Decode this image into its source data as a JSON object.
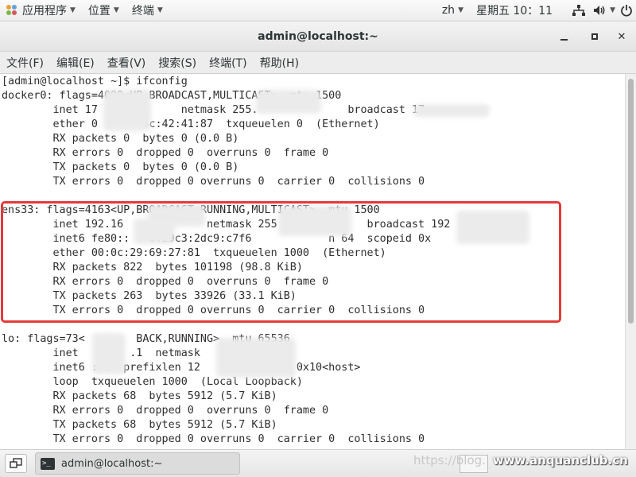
{
  "top_panel": {
    "applications": "应用程序",
    "places": "位置",
    "terminal": "终端",
    "input_method": "zh",
    "clock": "星期五 10：11",
    "icons": [
      "network-icon",
      "volume-icon",
      "power-icon"
    ]
  },
  "window": {
    "title": "admin@localhost:~",
    "controls": [
      "minimize-icon",
      "maximize-icon",
      "close-icon"
    ]
  },
  "menubar": {
    "items": [
      "文件(F)",
      "编辑(E)",
      "查看(V)",
      "搜索(S)",
      "终端(T)",
      "帮助(H)"
    ]
  },
  "terminal": {
    "lines": [
      "[admin@localhost ~]$ ifconfig",
      "docker0: flags=4099<UP,BROADCAST,MULTICAST>  mtu 1500",
      "        inet 17             netmask 255.              broadcast 17",
      "        ether 0       4c:42:41:87  txqueuelen 0  (Ethernet)",
      "        RX packets 0  bytes 0 (0.0 B)",
      "        RX errors 0  dropped 0  overruns 0  frame 0",
      "        TX packets 0  bytes 0 (0.0 B)",
      "        TX errors 0  dropped 0 overruns 0  carrier 0  collisions 0",
      "",
      "ens33: flags=4163<UP,BROADCAST,RUNNING,MULTICAST>  mtu 1500",
      "        inet 192.16             netmask 255              broadcast 192",
      "        inet6 fe80::   0:29c3:2dc9:c7f6            n 64  scopeid 0x",
      "        ether 00:0c:29:69:27:81  txqueuelen 1000  (Ethernet)",
      "        RX packets 822  bytes 101198 (98.8 KiB)",
      "        RX errors 0  dropped 0  overruns 0  frame 0",
      "        TX packets 263  bytes 33926 (33.1 KiB)",
      "        TX errors 0  dropped 0 overruns 0  carrier 0  collisions 0",
      "",
      "lo: flags=73<        BACK,RUNNING>  mtu 65536",
      "        inet        .1  netmask",
      "        inet6 ::1  prefixlen 12               0x10<host>",
      "        loop  txqueuelen 1000  (Local Loopback)",
      "        RX packets 68  bytes 5912 (5.7 KiB)",
      "        RX errors 0  dropped 0  overruns 0  frame 0",
      "        TX packets 68  bytes 5912 (5.7 KiB)",
      "        TX errors 0  dropped 0 overruns 0  carrier 0  collisions 0"
    ]
  },
  "taskbar": {
    "task_label": "admin@localhost:~",
    "watermark_url": "https://blog.",
    "watermark_site": "www.anquanclub.cn"
  },
  "colors": {
    "highlight_border": "#e43a3a",
    "terminal_text": "#2e2e2e"
  }
}
